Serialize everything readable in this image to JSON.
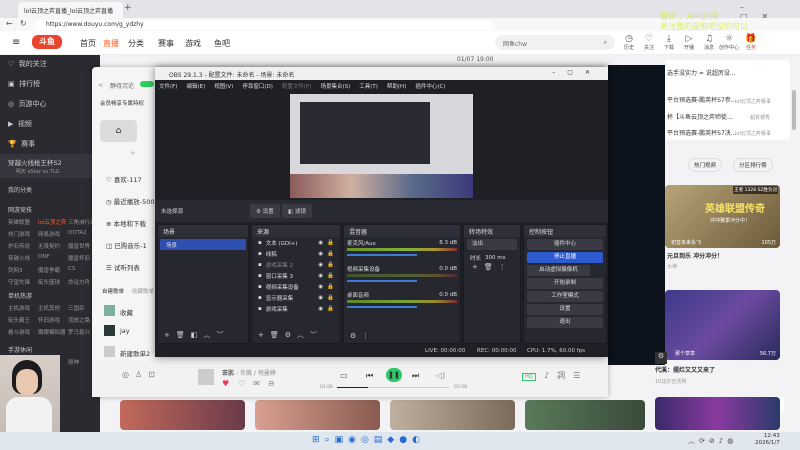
{
  "browser": {
    "tab_title": "lol云顶之弈直播_lol云顶之弈直播",
    "url": "https://www.douyu.com/g_ydzhy",
    "new_tab": "+"
  },
  "douyu": {
    "nav": [
      "首页",
      "直播",
      "分类",
      "赛事",
      "游戏",
      "鱼吧"
    ],
    "search_placeholder": "网鱼chw",
    "toolbar": [
      "历史",
      "关注",
      "下载",
      "开播",
      "消息",
      "创作中心",
      "任务"
    ],
    "date_text": "01/07 19:00"
  },
  "sidebar": {
    "items": [
      "我的关注",
      "排行榜",
      "页游中心",
      "视频",
      "赛事"
    ],
    "event_title": "穿越火线枪王杯S2",
    "event_sub": "明天 eStar vs TLG",
    "my_categories": "我的分类",
    "net_games": "网游竞技",
    "net_games_list": [
      "英雄联盟",
      "lol云顶之弈",
      "三角洲行动",
      "热门游戏",
      "网易游戏",
      "DOTA2",
      "炉石传说",
      "无畏契约",
      "魔兽世界",
      "穿越火线",
      "DNF",
      "魔兽怀旧",
      "剑网3",
      "魔兽争霸",
      "CS",
      "守望先锋",
      "街头篮球",
      "命运方舟"
    ],
    "single_games": "单机热游",
    "single_list": [
      "主机游戏",
      "主机其他",
      "三国杀",
      "街头霸王",
      "怀旧游戏",
      "流放之路",
      "格斗游戏",
      "鹰眼模拟器",
      "罗马复兴"
    ],
    "mobile": "手游休闲",
    "mobile_list": [
      "王者荣耀",
      "和平精英",
      "原神"
    ]
  },
  "music": {
    "back": "<",
    "user": "静待沉沦",
    "vip": "会员畅享专属特权",
    "menu": [
      "喜欢-117",
      "最近播放-500",
      "本地和下载",
      "已购音乐-1",
      "试听列表"
    ],
    "playlist_tabs": [
      "自建歌单",
      "收藏歌单"
    ],
    "playlists": [
      "收藏",
      "jay",
      "新建歌单2"
    ],
    "player": {
      "song": "寰鹏",
      "artist": " - 许嵩 / 何曼婷",
      "time_current": "01:06",
      "time_total": "03:58",
      "progress": 0.28,
      "quality": "HQ"
    }
  },
  "obs": {
    "title": "OBS 29.1.3 - 配置文件: 未命名 - 场景: 未命名",
    "menu": [
      "文件(F)",
      "编辑(E)",
      "视图(V)",
      "停靠窗口(D)",
      "配置文件(P)",
      "场景集合(S)",
      "工具(T)",
      "帮助(H)",
      "插件中心(C)"
    ],
    "no_source": "未选择源",
    "props_btn": "设置",
    "filters_btn": "滤镜",
    "scenes": {
      "title": "场景",
      "items": [
        "场景"
      ]
    },
    "sources": {
      "title": "来源",
      "items": [
        "文本 (GDI+)",
        "线稿",
        "游戏采集 2",
        "窗口采集 3",
        "视频采集设备",
        "显示器采集",
        "游戏采集"
      ]
    },
    "mixer": {
      "title": "混音器",
      "channels": [
        {
          "name": "麦克风/Aux",
          "db": "8.3 dB",
          "level": 0.55
        },
        {
          "name": "视频采集设备",
          "db": "0.0 dB",
          "level": 0
        },
        {
          "name": "桌面音频",
          "db": "0.0 dB",
          "level": 0.45
        }
      ]
    },
    "transitions": {
      "title": "转场特效",
      "type": "淡出",
      "duration_label": "时长",
      "duration": "300 ms"
    },
    "controls": {
      "title": "控制按钮",
      "buttons": [
        "插件中心",
        "停止直播",
        "启动虚拟摄像机",
        "开始录制",
        "工作室模式",
        "设置",
        "退出"
      ]
    },
    "status": {
      "live": "LIVE: 00:00:00",
      "rec": "REC: 00:00:00",
      "cpu": "CPU: 1.7%, 60.00 fps"
    }
  },
  "right": {
    "news": [
      "选手没实力 = 说超厉没...",
      "平台预选赛-鹏英杯S7参...",
      "杯【斗鱼云顶之弈师徒...",
      "平台预选赛-鹏英杯S7决..."
    ],
    "news_tags": [
      "lol云顶之弈赛事",
      "超有梗秀",
      "lol云顶之弈赛事"
    ],
    "hot_video": "热门视频",
    "rank": "分区排行榜",
    "card1": {
      "badge": "王者 1328 SZ胜负冠",
      "title_art": "英雄联盟传奇",
      "sub_art": "冲冲赛季冲分中！",
      "streamer": "初音未来永飞",
      "viewers": "105万",
      "caption": "元旦到乐 冲分冲分！",
      "tag": "大神"
    },
    "card2": {
      "streamer": "那个草草",
      "viewers": "56.7万",
      "caption": "代溪：摆烂又又又来了",
      "tag": "10比尔吉沃特"
    }
  },
  "overlay_text": [
    "喜欢 ，鸡叫的网",
    "关注我的是狗吧没的可以"
  ],
  "taskbar": {
    "time": "12:43",
    "date": "2026/1/7"
  }
}
